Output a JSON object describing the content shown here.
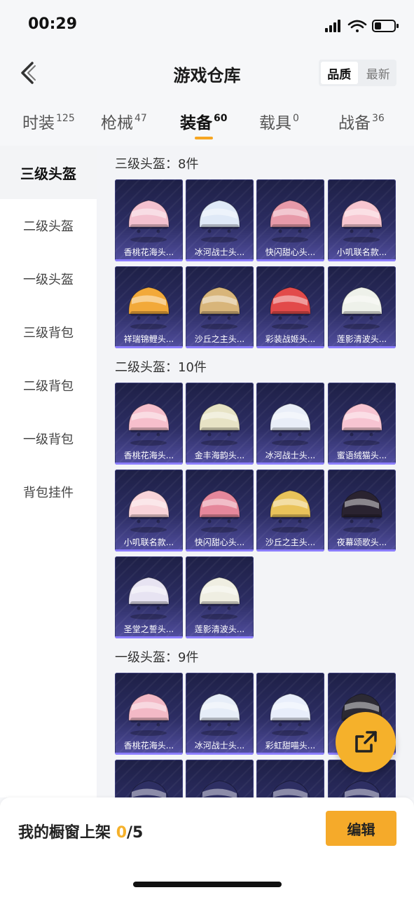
{
  "status_bar": {
    "time": "00:29"
  },
  "header": {
    "title": "游戏仓库",
    "sort_options": [
      "品质",
      "最新"
    ],
    "active_sort": "品质"
  },
  "tabs": [
    {
      "label": "时装",
      "count": "125"
    },
    {
      "label": "枪械",
      "count": "47"
    },
    {
      "label": "装备",
      "count": "60",
      "active": true
    },
    {
      "label": "载具",
      "count": "0"
    },
    {
      "label": "战备",
      "count": "36"
    }
  ],
  "sidebar": {
    "items": [
      {
        "label": "三级头盔",
        "active": true
      },
      {
        "label": "二级头盔"
      },
      {
        "label": "一级头盔"
      },
      {
        "label": "三级背包"
      },
      {
        "label": "二级背包"
      },
      {
        "label": "一级背包"
      },
      {
        "label": "背包挂件"
      }
    ]
  },
  "sections": [
    {
      "title": "三级头盔：8件",
      "items": [
        {
          "name": "香桃花海头...",
          "color": "#f3c1cf"
        },
        {
          "name": "冰河战士头...",
          "color": "#dfe9f7"
        },
        {
          "name": "快闪甜心头...",
          "color": "#e79aa9"
        },
        {
          "name": "小叽联名款...",
          "color": "#f7c6d0"
        },
        {
          "name": "祥瑞锦鲤头...",
          "color": "#f2a93a"
        },
        {
          "name": "沙丘之主头...",
          "color": "#d8b57a"
        },
        {
          "name": "彩装战姬头...",
          "color": "#e24a4a"
        },
        {
          "name": "莲影清波头...",
          "color": "#eef1ea"
        }
      ]
    },
    {
      "title": "二级头盔：10件",
      "items": [
        {
          "name": "香桃花海头...",
          "color": "#f6bfcc"
        },
        {
          "name": "金丰海韵头...",
          "color": "#e7e3c5"
        },
        {
          "name": "冰河战士头...",
          "color": "#e9eef8"
        },
        {
          "name": "蜜语绒猫头...",
          "color": "#f7c4d2"
        },
        {
          "name": "小叽联名款...",
          "color": "#f8d3d9"
        },
        {
          "name": "快闪甜心头...",
          "color": "#e5879b"
        },
        {
          "name": "沙丘之主头...",
          "color": "#e9c35a"
        },
        {
          "name": "夜幕颂歌头...",
          "color": "#2a2330"
        },
        {
          "name": "圣堂之誓头...",
          "color": "#e7e3f2"
        },
        {
          "name": "莲影清波头...",
          "color": "#efeee2"
        }
      ]
    },
    {
      "title": "一级头盔：9件",
      "items": [
        {
          "name": "香桃花海头...",
          "color": "#f3b9c6"
        },
        {
          "name": "冰河战士头...",
          "color": "#e6edf8"
        },
        {
          "name": "彩虹甜喵头...",
          "color": "#e8eefb"
        },
        {
          "name": "",
          "color": "#2c2a33"
        },
        {
          "name": "",
          "color": "#2e2f63"
        },
        {
          "name": "",
          "color": "#2e2f63"
        },
        {
          "name": "",
          "color": "#2e2f63"
        },
        {
          "name": "",
          "color": "#2e2f63"
        }
      ]
    }
  ],
  "bottom_bar": {
    "shelf_label": "我的橱窗上架",
    "shelf_current": "0",
    "shelf_total": "/5",
    "edit_label": "编辑"
  }
}
